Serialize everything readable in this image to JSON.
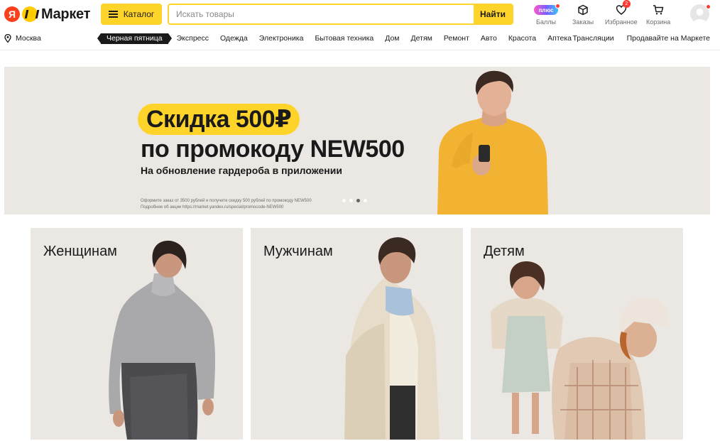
{
  "header": {
    "logo_ya": "Я",
    "logo_text": "Маркет",
    "catalog_label": "Каталог",
    "search_placeholder": "Искать товары",
    "search_button": "Найти",
    "actions": {
      "plus_pill": "плюс",
      "points_label": "Баллы",
      "orders_label": "Заказы",
      "favorites_label": "Избранное",
      "favorites_badge": "2",
      "cart_label": "Корзина"
    }
  },
  "nav": {
    "city": "Москва",
    "black_friday": "Черная пятница",
    "items": [
      "Экспресс",
      "Одежда",
      "Электроника",
      "Бытовая техника",
      "Дом",
      "Детям",
      "Ремонт",
      "Авто",
      "Красота",
      "Аптека"
    ],
    "right": [
      "Трансляции",
      "Продавайте на Маркете"
    ]
  },
  "hero": {
    "title_pill": "Скидка 500₽",
    "title_line2": "по промокоду NEW500",
    "subtitle": "На обновление гардероба в приложении",
    "fine_print_1": "Оформите заказ от 3500 рублей и получите скидку 500 рублей по промокоду NEW500",
    "fine_print_2": "Подробнее об акции https://market.yandex.ru/special/promocode-NEW500",
    "slides_count": 4,
    "active_slide": 3
  },
  "categories": [
    {
      "title": "Женщинам"
    },
    {
      "title": "Мужчинам"
    },
    {
      "title": "Детям"
    }
  ],
  "colors": {
    "brand_yellow": "#fed42b",
    "brand_red": "#fc3f1d",
    "card_bg": "#ebe8e4",
    "badge_red": "#ff3b30"
  }
}
